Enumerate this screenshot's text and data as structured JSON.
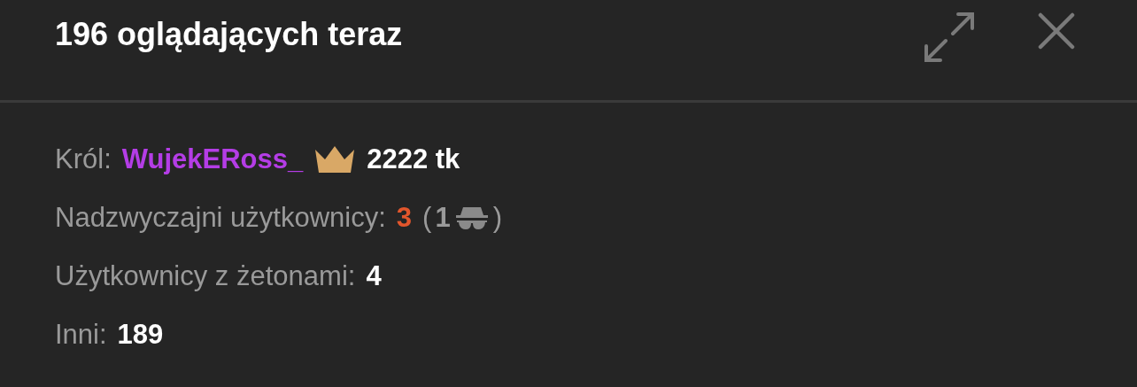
{
  "header": {
    "title": "196 oglądających teraz"
  },
  "stats": [
    {
      "kind": "king",
      "label": "Król:",
      "username": "WujekERoss_",
      "amount": "2222 tk"
    },
    {
      "kind": "special",
      "label": "Nadzwyczajni użytkownicy:",
      "count": "3",
      "open": "(",
      "hidden_count": "1",
      "close": ")"
    },
    {
      "kind": "plain",
      "label": "Użytkownicy z żetonami:",
      "count": "4"
    },
    {
      "kind": "plain",
      "label": "Inni:",
      "count": "189"
    }
  ]
}
